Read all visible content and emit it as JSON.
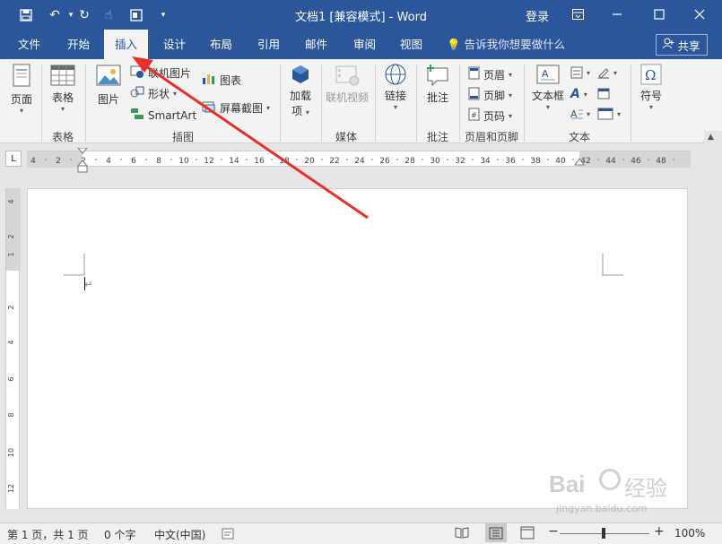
{
  "window": {
    "title": "文档1 [兼容模式] - Word",
    "login_label": "登录"
  },
  "tabs": [
    {
      "label": "文件"
    },
    {
      "label": "开始"
    },
    {
      "label": "插入"
    },
    {
      "label": "设计"
    },
    {
      "label": "布局"
    },
    {
      "label": "引用"
    },
    {
      "label": "邮件"
    },
    {
      "label": "审阅"
    },
    {
      "label": "视图"
    }
  ],
  "tellme": {
    "placeholder": "告诉我你想要做什么"
  },
  "share_label": "共享",
  "ribbon": {
    "pages": {
      "label": "页面"
    },
    "table": {
      "label": "表格",
      "group": "表格"
    },
    "picture": {
      "label": "图片"
    },
    "online_picture": {
      "label": "联机图片"
    },
    "shapes": {
      "label": "形状"
    },
    "smartart": {
      "label": "SmartArt"
    },
    "chart": {
      "label": "图表"
    },
    "screenshot": {
      "label": "屏幕截图"
    },
    "illustrations_group": "插图",
    "addins": {
      "label1": "加载",
      "label2": "项"
    },
    "online_video": {
      "label": "联机视频"
    },
    "media_group": "媒体",
    "link": {
      "label": "链接"
    },
    "comment": {
      "label": "批注",
      "group": "批注"
    },
    "header": {
      "label": "页眉"
    },
    "footer": {
      "label": "页脚"
    },
    "page_number": {
      "label": "页码"
    },
    "header_footer_group": "页眉和页脚",
    "textbox": {
      "label": "文本框"
    },
    "text_group": "文本",
    "symbol": {
      "label": "符号"
    }
  },
  "ruler": {
    "h_labels": [
      "4",
      "2",
      "2",
      "4",
      "6",
      "8",
      "10",
      "12",
      "14",
      "16",
      "18",
      "20",
      "22",
      "24",
      "26",
      "28",
      "30",
      "32",
      "34",
      "36",
      "38",
      "40",
      "42",
      "44",
      "46",
      "48"
    ],
    "v_labels": [
      "4",
      "2",
      "1",
      "2",
      "4",
      "6",
      "8",
      "10",
      "12"
    ]
  },
  "statusbar": {
    "page": "第 1 页，共 1 页",
    "words": "0 个字",
    "language": "中文(中国)",
    "zoom": "100%"
  },
  "watermark": {
    "text1": "Bai",
    "text2": "经验",
    "text3": "jingyan.baidu.com"
  },
  "colors": {
    "accent": "#2b579a",
    "arrow": "#e8302a"
  }
}
